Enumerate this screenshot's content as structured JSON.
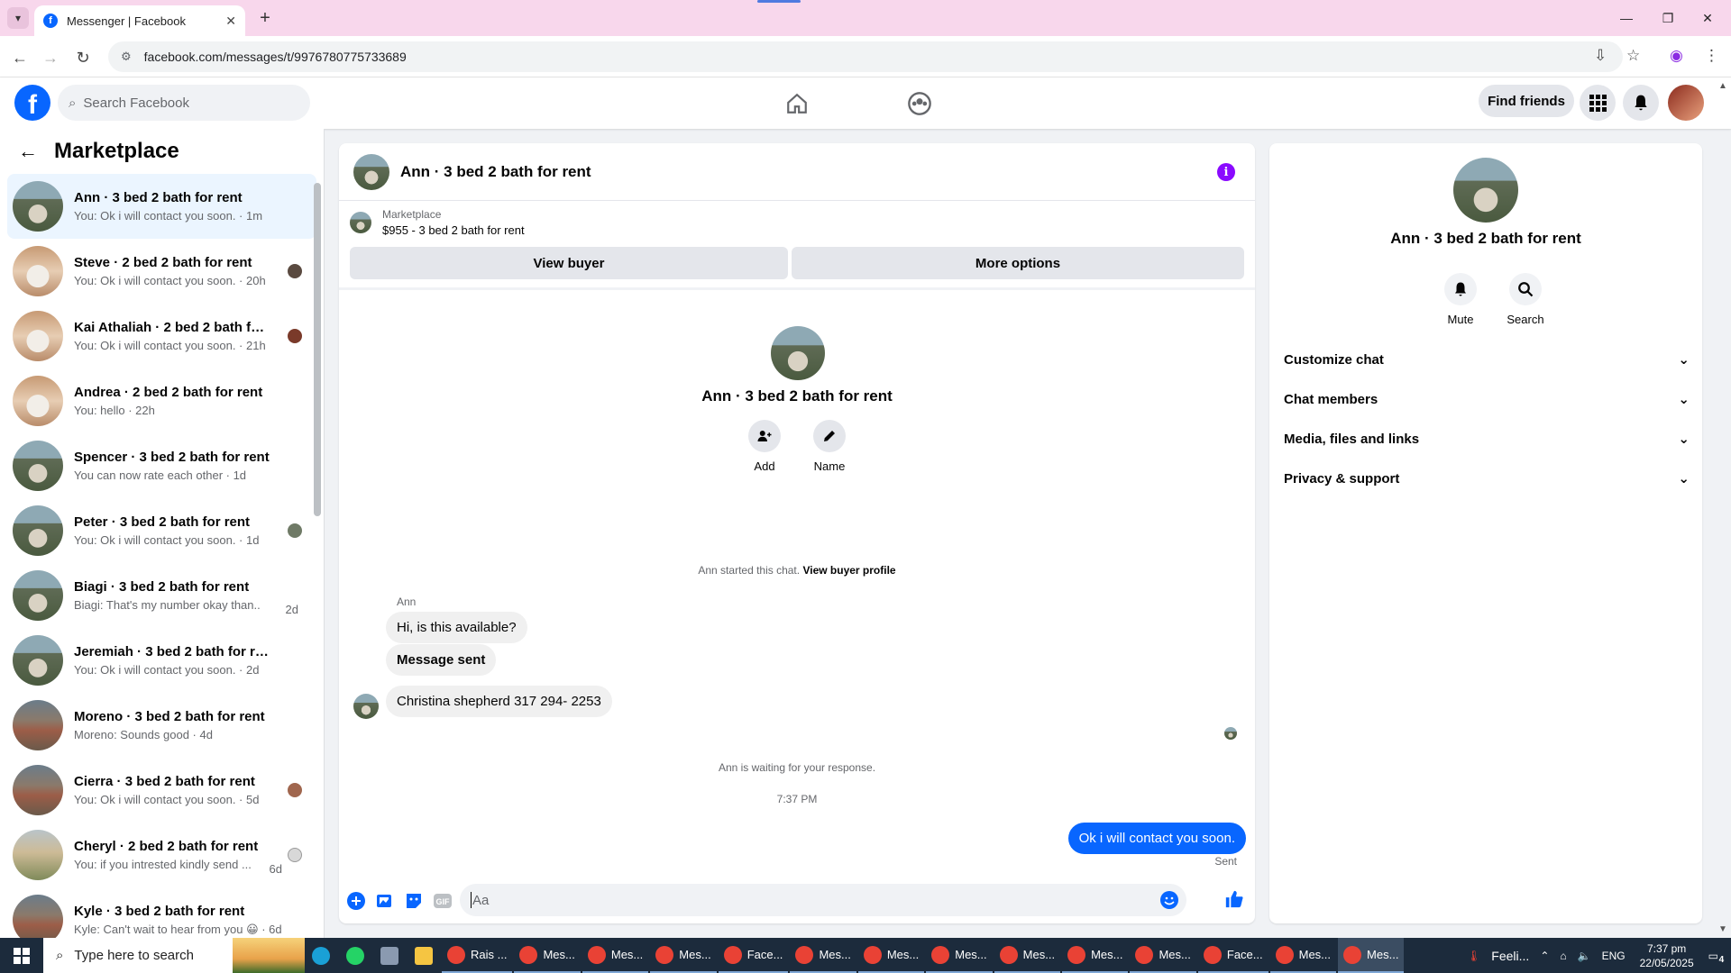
{
  "browser": {
    "tab_title": "Messenger | Facebook",
    "url": "facebook.com/messages/t/9976780775733689"
  },
  "fb": {
    "search_placeholder": "Search Facebook",
    "find_friends": "Find friends"
  },
  "sidebar": {
    "title": "Marketplace",
    "conversations": [
      {
        "name": "Ann · 3 bed 2 bath for rent",
        "last": "You: Ok i will contact you soon. · 1m"
      },
      {
        "name": "Steve · 2 bed 2 bath for rent",
        "last": "You: Ok i will contact you soon. · 20h"
      },
      {
        "name": "Kai Athaliah · 2 bed 2 bath for...",
        "last": "You: Ok i will contact you soon. · 21h"
      },
      {
        "name": "Andrea · 2 bed 2 bath for rent",
        "last": "You: hello · 22h"
      },
      {
        "name": "Spencer · 3 bed 2 bath for rent",
        "last": "You can now rate each other · 1d"
      },
      {
        "name": "Peter · 3 bed 2 bath for rent",
        "last": "You: Ok i will contact you soon. · 1d"
      },
      {
        "name": "Biagi · 3 bed 2 bath for rent",
        "last": "Biagi: That's my number okay than...",
        "time": "2d"
      },
      {
        "name": "Jeremiah · 3 bed 2 bath for rent",
        "last": "You: Ok i will contact you soon. · 2d"
      },
      {
        "name": "Moreno · 3 bed 2 bath for rent",
        "last": "Moreno: Sounds good · 4d"
      },
      {
        "name": "Cierra · 3 bed 2 bath for rent",
        "last": "You: Ok i will contact you soon. · 5d"
      },
      {
        "name": "Cheryl · 2 bed 2 bath for rent",
        "last": "You: if you intrested kindly send ...",
        "time": "6d"
      },
      {
        "name": "Kyle · 3 bed 2 bath for rent",
        "last": "Kyle: Can't wait to hear from you 😀 · 6d"
      }
    ]
  },
  "chat": {
    "title": "Ann · 3 bed 2 bath for rent",
    "listing_category": "Marketplace",
    "listing_price": "$955 - 3 bed 2 bath for rent",
    "view_buyer": "View buyer",
    "more_options": "More options",
    "intro_name": "Ann · 3 bed 2 bath for rent",
    "add_label": "Add",
    "name_label": "Name",
    "started_text": "Ann started this chat.",
    "view_buyer_profile": "View buyer profile",
    "sender": "Ann",
    "messages_in": [
      "Hi, is this available?",
      "Message sent",
      "Christina shepherd 317 294- 2253"
    ],
    "waiting_text": "Ann is waiting for your response.",
    "timestamp": "7:37 PM",
    "message_out": "Ok i will contact you soon.",
    "sent_label": "Sent",
    "composer_placeholder": "Aa"
  },
  "details": {
    "name": "Ann · 3 bed 2 bath for rent",
    "mute": "Mute",
    "search": "Search",
    "sections": [
      "Customize chat",
      "Chat members",
      "Media, files and links",
      "Privacy & support"
    ]
  },
  "taskbar": {
    "search_placeholder": "Type here to search",
    "apps": [
      "Rais ...",
      "Mes...",
      "Mes...",
      "Mes...",
      "Face...",
      "Mes...",
      "Mes...",
      "Mes...",
      "Mes...",
      "Mes...",
      "Mes...",
      "Face...",
      "Mes...",
      "Mes..."
    ],
    "weather": "Feeli...",
    "lang": "ENG",
    "time": "7:37 pm",
    "date": "22/05/2025",
    "notif_count": "4"
  },
  "colors": {
    "fb_blue": "#0866ff",
    "info_purple": "#8a0aff",
    "active_conv": "#ebf5ff",
    "tab_strip": "#f8d7ec"
  }
}
